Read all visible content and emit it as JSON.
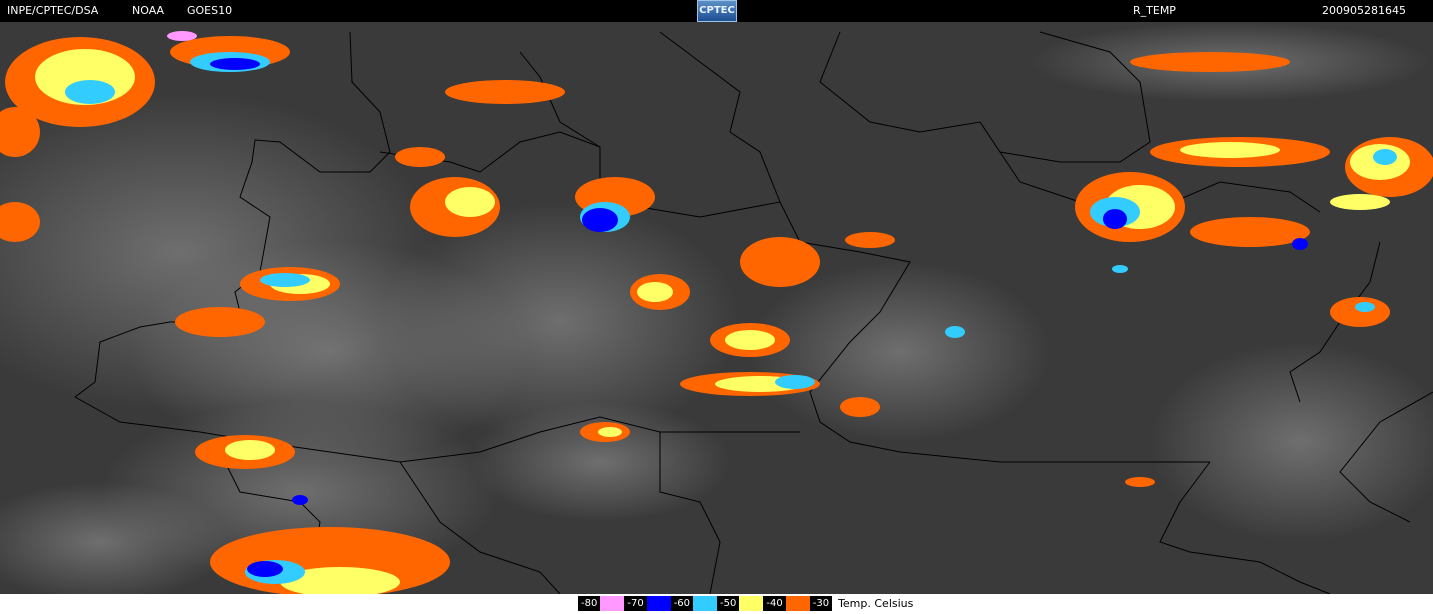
{
  "header": {
    "source": "INPE/CPTEC/DSA",
    "agency": "NOAA",
    "satellite": "GOES10",
    "logo_text": "CPTEC",
    "product": "R_TEMP",
    "timestamp": "200905281645"
  },
  "legend": {
    "items": [
      {
        "label": "-80",
        "color": "#ff99ff"
      },
      {
        "label": "-70",
        "color": "#0000ff"
      },
      {
        "label": "-60",
        "color": "#33ccff"
      },
      {
        "label": "-50",
        "color": "#ffff66"
      },
      {
        "label": "-40",
        "color": "#ff6600"
      },
      {
        "label": "-30",
        "color": ""
      }
    ],
    "unit": "Temp. Celsius"
  }
}
